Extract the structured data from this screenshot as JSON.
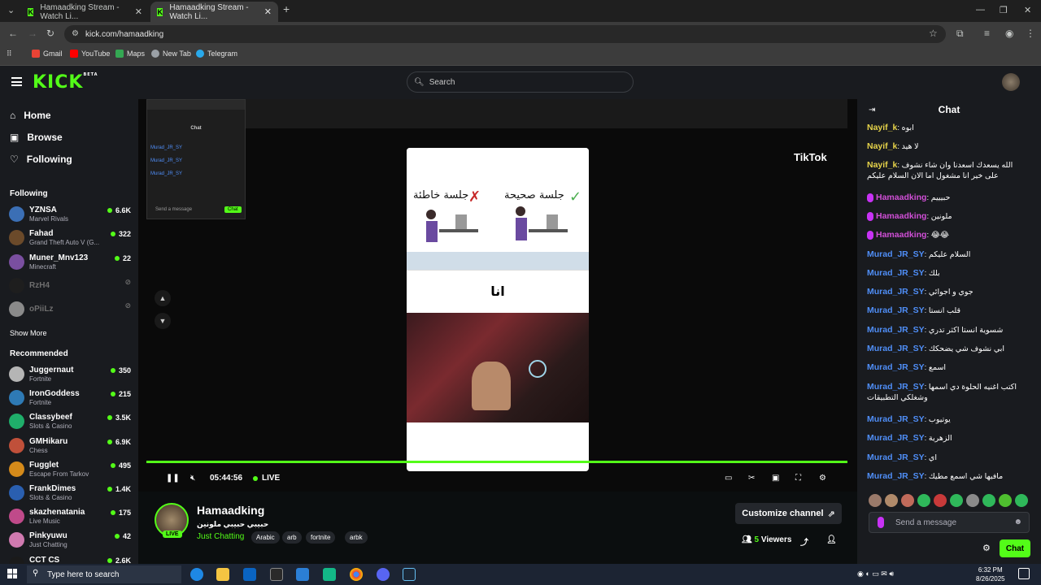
{
  "browser": {
    "tabs": [
      {
        "title": "Hamaadking Stream - Watch Li..."
      },
      {
        "title": "Hamaadking Stream - Watch Li..."
      }
    ],
    "url": "kick.com/hamaadking",
    "bookmarks": [
      "Gmail",
      "YouTube",
      "Maps",
      "New Tab",
      "Telegram"
    ]
  },
  "header": {
    "logo": "KICK",
    "logo_sup": "BETA",
    "search_placeholder": "Search"
  },
  "sidebar": {
    "nav": [
      "Home",
      "Browse",
      "Following"
    ],
    "following_title": "Following",
    "following": [
      {
        "name": "YZNSA",
        "category": "Marvel Rivals",
        "viewers": "6.6K",
        "color": "#3b6fb5"
      },
      {
        "name": "Fahad",
        "category": "Grand Theft Auto V (G...",
        "viewers": "322",
        "color": "#6b4a2a"
      },
      {
        "name": "Muner_Mnv123",
        "category": "Minecraft",
        "viewers": "22",
        "color": "#7a4fa0"
      },
      {
        "name": "RzH4",
        "category": "",
        "viewers": "",
        "color": "#1e1e1e"
      },
      {
        "name": "oPiiLz",
        "category": "",
        "viewers": "",
        "color": "#8a8a8a"
      }
    ],
    "show_more": "Show More",
    "recommended_title": "Recommended",
    "recommended": [
      {
        "name": "Juggernaut",
        "category": "Fortnite",
        "viewers": "350",
        "color": "#b5b5b5"
      },
      {
        "name": "IronGoddess",
        "category": "Fortnite",
        "viewers": "215",
        "color": "#2e7ab5"
      },
      {
        "name": "Classybeef",
        "category": "Slots & Casino",
        "viewers": "3.5K",
        "color": "#1fae6a"
      },
      {
        "name": "GMHikaru",
        "category": "Chess",
        "viewers": "6.9K",
        "color": "#c0503a"
      },
      {
        "name": "Fugglet",
        "category": "Escape From Tarkov",
        "viewers": "495",
        "color": "#d48a1a"
      },
      {
        "name": "FrankDimes",
        "category": "Slots & Casino",
        "viewers": "1.4K",
        "color": "#2a5fb0"
      },
      {
        "name": "skazhenatania",
        "category": "Live Music",
        "viewers": "175",
        "color": "#c04a8a"
      },
      {
        "name": "Pinkyuwu",
        "category": "Just Chatting",
        "viewers": "42",
        "color": "#d07ab0"
      },
      {
        "name": "CCT CS",
        "category": "",
        "viewers": "2.6K",
        "color": "#1a1a1a"
      }
    ]
  },
  "video": {
    "time": "05:44:56",
    "live_label": "LIVE",
    "tiktok": "TikTok",
    "phone_mid": "انا",
    "popout_title": "Chat",
    "popout_send": "Send a message",
    "popout_chat_btn": "Chat"
  },
  "stream": {
    "name": "Hamaadking",
    "live_badge": "LIVE",
    "title": "حبيبي حبيبي ملونين",
    "category": "Just Chatting",
    "tags": [
      "Arabic",
      "arb",
      "fortnite",
      "arbk"
    ],
    "customize_label": "Customize channel",
    "viewers_count": "5",
    "viewers_label": "Viewers"
  },
  "chat": {
    "title": "Chat",
    "messages": [
      {
        "user": "Nayif_k",
        "text": "ابوه",
        "color": "#e6d34a",
        "badge": false
      },
      {
        "user": "Nayif_k",
        "text": "لا هيد",
        "color": "#e6d34a",
        "badge": false
      },
      {
        "user": "Nayif_k",
        "text": "الله يسعدك اسعدنا وان شاء نشوف على خير انا مشغول اما الان السلام عليكم",
        "color": "#e6d34a",
        "badge": false
      },
      {
        "user": "Hamaadking",
        "text": "حبيييم",
        "color": "#d04fd6",
        "badge": true
      },
      {
        "user": "Hamaadking",
        "text": "ملونين",
        "color": "#d04fd6",
        "badge": true
      },
      {
        "user": "Hamaadking",
        "text": "😂😂",
        "color": "#d04fd6",
        "badge": true
      },
      {
        "user": "Murad_JR_SY",
        "text": "السلام عليكم",
        "color": "#4f8ef7",
        "badge": false
      },
      {
        "user": "Murad_JR_SY",
        "text": "بلك",
        "color": "#4f8ef7",
        "badge": false
      },
      {
        "user": "Murad_JR_SY",
        "text": "جوي و اجوائي",
        "color": "#4f8ef7",
        "badge": false
      },
      {
        "user": "Murad_JR_SY",
        "text": "قلب انستا",
        "color": "#4f8ef7",
        "badge": false
      },
      {
        "user": "Murad_JR_SY",
        "text": "شسوية انستا اكثر تدري",
        "color": "#4f8ef7",
        "badge": false
      },
      {
        "user": "Murad_JR_SY",
        "text": "ابي نشوف شي يضحكك",
        "color": "#4f8ef7",
        "badge": false
      },
      {
        "user": "Murad_JR_SY",
        "text": "اسمع",
        "color": "#4f8ef7",
        "badge": false
      },
      {
        "user": "Murad_JR_SY",
        "text": "اكتب اغنيه الحلوة دي اسمها وشغلكي التطبيقات",
        "color": "#4f8ef7",
        "badge": false
      },
      {
        "user": "Murad_JR_SY",
        "text": "يوتيوب",
        "color": "#4f8ef7",
        "badge": false
      },
      {
        "user": "Murad_JR_SY",
        "text": "الزهرية",
        "color": "#4f8ef7",
        "badge": false
      },
      {
        "user": "Murad_JR_SY",
        "text": "اي",
        "color": "#4f8ef7",
        "badge": false
      },
      {
        "user": "Murad_JR_SY",
        "text": "مافيها شي اسمع مطيك",
        "color": "#4f8ef7",
        "badge": false
      }
    ],
    "input_placeholder": "Send a message",
    "send_label": "Chat"
  },
  "taskbar": {
    "search_placeholder": "Type here to search",
    "time": "6:32 PM",
    "date": "8/26/2025"
  }
}
